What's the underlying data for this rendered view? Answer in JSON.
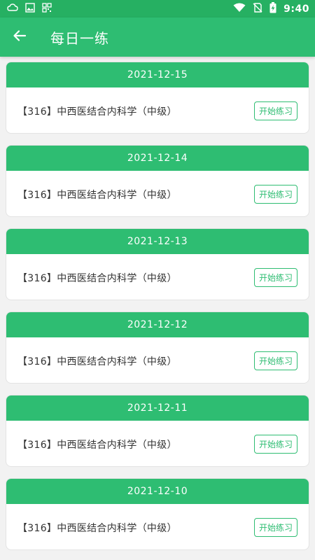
{
  "status_bar": {
    "time": "9:40",
    "icons": [
      "notification-cloud-icon",
      "image-icon",
      "qr-code-icon",
      "wifi-icon",
      "no-sim-icon",
      "battery-charging-icon"
    ]
  },
  "app_bar": {
    "title": "每日一练",
    "back_icon": "arrow-left-icon"
  },
  "colors": {
    "primary": "#2ebd72",
    "status_bar": "#26b062",
    "background": "#f2f2f2",
    "text": "#333333"
  },
  "cards": [
    {
      "date": "2021-12-15",
      "title": "【316】中西医结合内科学（中级）",
      "button": "开始练习"
    },
    {
      "date": "2021-12-14",
      "title": "【316】中西医结合内科学（中级）",
      "button": "开始练习"
    },
    {
      "date": "2021-12-13",
      "title": "【316】中西医结合内科学（中级）",
      "button": "开始练习"
    },
    {
      "date": "2021-12-12",
      "title": "【316】中西医结合内科学（中级）",
      "button": "开始练习"
    },
    {
      "date": "2021-12-11",
      "title": "【316】中西医结合内科学（中级）",
      "button": "开始练习"
    },
    {
      "date": "2021-12-10",
      "title": "【316】中西医结合内科学（中级）",
      "button": "开始练习"
    }
  ]
}
